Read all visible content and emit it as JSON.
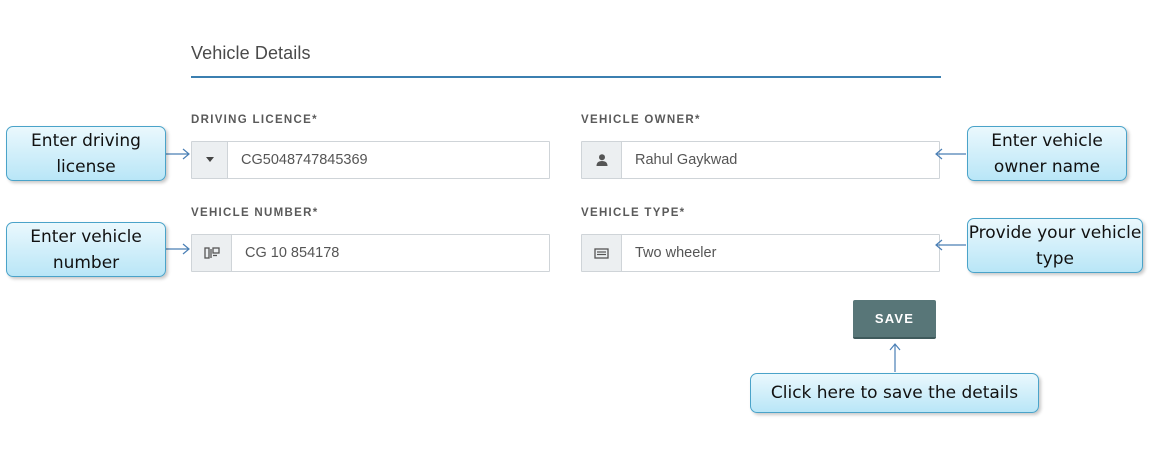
{
  "section": {
    "title": "Vehicle Details"
  },
  "fields": {
    "driving_licence": {
      "label": "DRIVING LICENCE*",
      "value": "CG5048747845369",
      "icon": "caret-down-icon"
    },
    "vehicle_owner": {
      "label": "VEHICLE OWNER*",
      "value": "Rahul Gaykwad",
      "icon": "user-icon"
    },
    "vehicle_number": {
      "label": "VEHICLE NUMBER*",
      "value": "CG 10 854178",
      "icon": "number-plate-icon"
    },
    "vehicle_type": {
      "label": "VEHICLE TYPE*",
      "value": "Two wheeler",
      "icon": "card-icon"
    }
  },
  "actions": {
    "save_label": "SAVE"
  },
  "callouts": {
    "driving_license": "Enter driving license",
    "vehicle_number": "Enter vehicle number",
    "owner_name": "Enter vehicle owner name",
    "vehicle_type": "Provide your vehicle type",
    "save": "Click here to save the details"
  },
  "colors": {
    "accent_line": "#3b7fb0",
    "save_button": "#587678",
    "callout_border": "#4aa3c9",
    "callout_fill": "#b9e6f7"
  }
}
